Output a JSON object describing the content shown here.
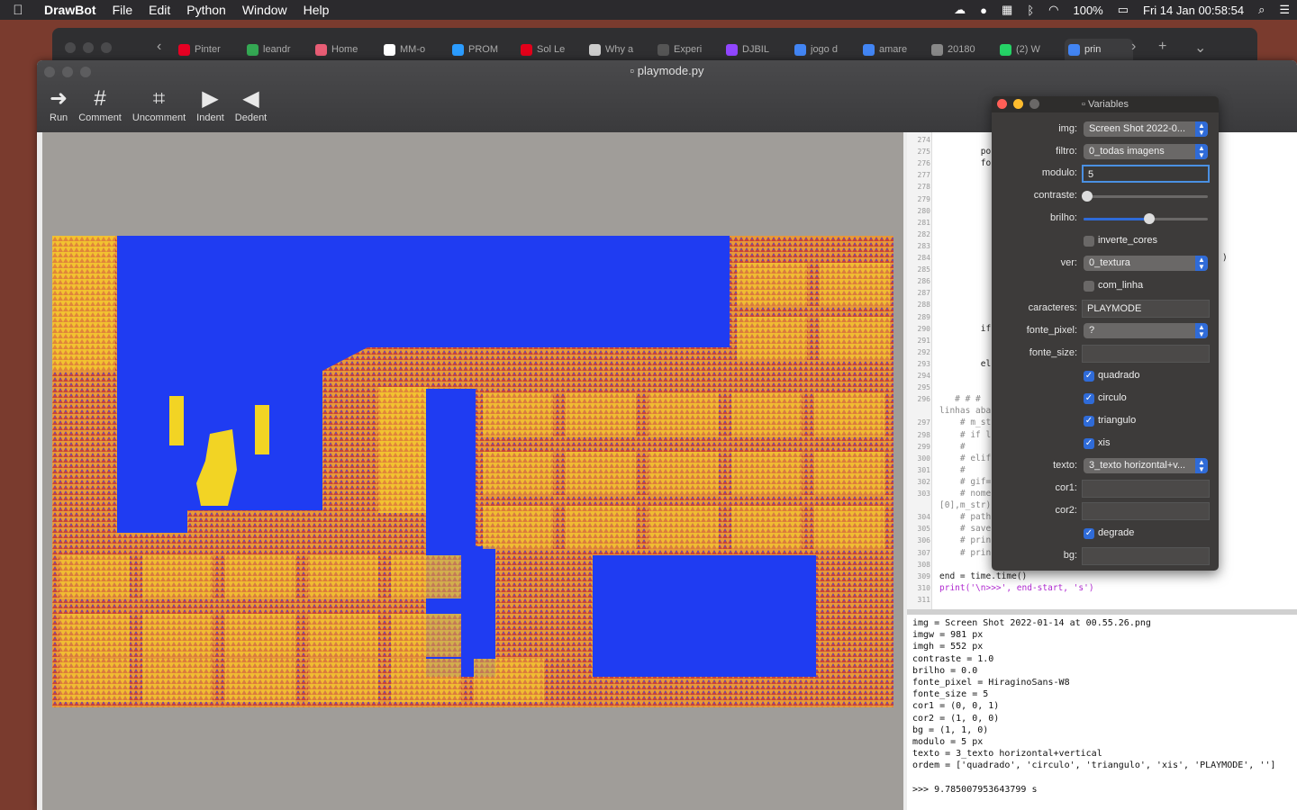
{
  "menubar": {
    "app": "DrawBot",
    "items": [
      "File",
      "Edit",
      "Python",
      "Window",
      "Help"
    ],
    "battery": "100%",
    "clock": "Fri 14 Jan  00:58:54"
  },
  "browser": {
    "tabs": [
      {
        "label": "Pinter",
        "color": "#e60023"
      },
      {
        "label": "leandr",
        "color": "#34a853"
      },
      {
        "label": "Home",
        "color": "#e85d75"
      },
      {
        "label": "MM-o",
        "color": "#ffffff"
      },
      {
        "label": "PROM",
        "color": "#2b9cff"
      },
      {
        "label": "Sol Le",
        "color": "#e2001a"
      },
      {
        "label": "Why a",
        "color": "#cccccc"
      },
      {
        "label": "Experi",
        "color": "#555555"
      },
      {
        "label": "DJBIL",
        "color": "#9146ff"
      },
      {
        "label": "jogo d",
        "color": "#4285f4"
      },
      {
        "label": "amare",
        "color": "#4285f4"
      },
      {
        "label": "20180",
        "color": "#888888"
      },
      {
        "label": "(2) W",
        "color": "#25d366"
      },
      {
        "label": "prin",
        "color": "#4285f4"
      }
    ]
  },
  "window": {
    "title": "playmode.py",
    "toolbar": [
      {
        "label": "Run",
        "icon": "run-arrow-icon",
        "glyph": "➜"
      },
      {
        "label": "Comment",
        "icon": "hash-icon",
        "glyph": "#"
      },
      {
        "label": "Uncomment",
        "icon": "uncomment-icon",
        "glyph": "⌗"
      },
      {
        "label": "Indent",
        "icon": "indent-icon",
        "glyph": "▶"
      },
      {
        "label": "Dedent",
        "icon": "dedent-icon",
        "glyph": "◀"
      }
    ]
  },
  "colors": {
    "blue": "#1f3cf2",
    "yellow": "#f2d424",
    "orange": "#e69a3a",
    "red": "#c8423a",
    "purple": "#6a4ab0"
  },
  "code": {
    "line_numbers": [
      "274",
      "275",
      "276",
      "277",
      "278",
      "279",
      "280",
      "281",
      "282",
      "283",
      "284",
      "285",
      "286",
      "287",
      "288",
      "289",
      "290",
      "291",
      "292",
      "293",
      "294",
      "295",
      "296",
      "",
      "297",
      "298",
      "299",
      "300",
      "301",
      "302",
      "303",
      "",
      "304",
      "305",
      "306",
      "307",
      "308",
      "309",
      "310",
      "311"
    ],
    "fragments": [
      {
        "line": 1,
        "text": "        po"
      },
      {
        "line": 2,
        "text": "        fo"
      },
      {
        "line": 16,
        "text": "        if"
      },
      {
        "line": 19,
        "text": "        el"
      },
      {
        "line": 22,
        "text": "   # # #                                   ente as"
      },
      {
        "line": 23,
        "text": "linhas aba"
      },
      {
        "line": 24,
        "text": "    # m_st"
      },
      {
        "line": 25,
        "text": "    # if l"
      },
      {
        "line": 26,
        "text": "    #"
      },
      {
        "line": 27,
        "text": "    # elif"
      },
      {
        "line": 28,
        "text": "    #"
      },
      {
        "line": 29,
        "text": "    # gif="
      },
      {
        "line": 30,
        "text": "    # nome                                    t('.')"
      },
      {
        "line": 31,
        "text": "[0],m_str)"
      },
      {
        "line": 32,
        "text": "    # path"
      },
      {
        "line": 33,
        "text": "    # save"
      },
      {
        "line": 34,
        "text": "    # prin"
      },
      {
        "line": 35,
        "text": "    # prin"
      },
      {
        "line": 37,
        "text": "end = time.time()"
      },
      {
        "line": 38,
        "text": "print('\\n>>>', end-start, 's')"
      }
    ],
    "paren_fragment": ")"
  },
  "console": {
    "lines": [
      "img = Screen Shot 2022-01-14 at 00.55.26.png",
      "imgw = 981 px",
      "imgh = 552 px",
      "contraste = 1.0",
      "brilho = 0.0",
      "fonte_pixel = HiraginoSans-W8",
      "fonte_size = 5",
      "cor1 = (0, 0, 1)",
      "cor2 = (1, 0, 0)",
      "bg = (1, 1, 0)",
      "modulo = 5 px",
      "texto = 3_texto horizontal+vertical",
      "ordem = ['quadrado', 'circulo', 'triangulo', 'xis', 'PLAYMODE', '']",
      "",
      ">>> 9.785007953643799 s"
    ]
  },
  "variables": {
    "title": "Variables",
    "img": {
      "label": "img:",
      "value": "Screen Shot 2022-0..."
    },
    "filtro": {
      "label": "filtro:",
      "value": "0_todas imagens"
    },
    "modulo": {
      "label": "modulo:",
      "value": "5"
    },
    "contraste": {
      "label": "contraste:",
      "level": 0.0
    },
    "brilho": {
      "label": "brilho:",
      "level": 0.5
    },
    "inverte_cores": {
      "label": "inverte_cores",
      "checked": false
    },
    "ver": {
      "label": "ver:",
      "value": "0_textura"
    },
    "com_linha": {
      "label": "com_linha",
      "checked": false
    },
    "caracteres": {
      "label": "caracteres:",
      "value": "PLAYMODE"
    },
    "fonte_pixel": {
      "label": "fonte_pixel:",
      "value": "?"
    },
    "fonte_size": {
      "label": "fonte_size:",
      "value": ""
    },
    "quadrado": {
      "label": "quadrado",
      "checked": true
    },
    "circulo": {
      "label": "circulo",
      "checked": true
    },
    "triangulo": {
      "label": "triangulo",
      "checked": true
    },
    "xis": {
      "label": "xis",
      "checked": true
    },
    "texto": {
      "label": "texto:",
      "value": "3_texto horizontal+v..."
    },
    "cor1": {
      "label": "cor1:",
      "value": ""
    },
    "cor2": {
      "label": "cor2:",
      "value": ""
    },
    "degrade": {
      "label": "degrade",
      "checked": true
    },
    "bg": {
      "label": "bg:",
      "value": ""
    }
  }
}
